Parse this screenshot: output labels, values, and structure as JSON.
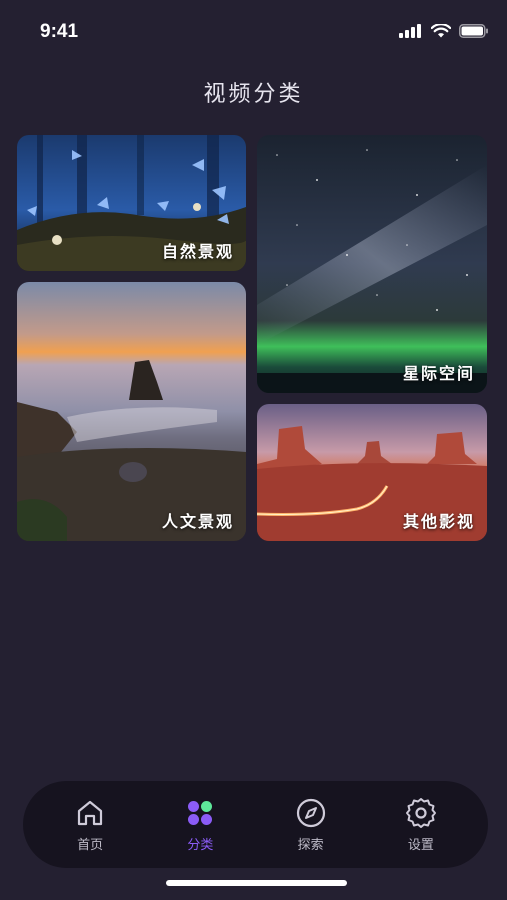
{
  "status": {
    "time": "9:41"
  },
  "page": {
    "title": "视频分类"
  },
  "categories": [
    {
      "label": "自然景观"
    },
    {
      "label": "星际空间"
    },
    {
      "label": "人文景观"
    },
    {
      "label": "其他影视"
    }
  ],
  "tabs": [
    {
      "label": "首页",
      "icon": "home-icon"
    },
    {
      "label": "分类",
      "icon": "category-icon",
      "active": true
    },
    {
      "label": "探索",
      "icon": "compass-icon"
    },
    {
      "label": "设置",
      "icon": "settings-icon"
    }
  ],
  "colors": {
    "background": "#242031",
    "tabbar": "#16131f",
    "accent": "#8b5cf6",
    "accent_green": "#5ee89a"
  }
}
